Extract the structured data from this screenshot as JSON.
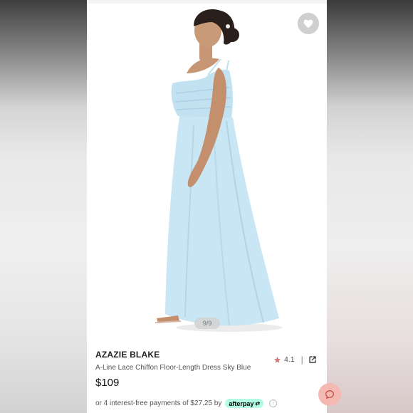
{
  "image": {
    "counter": "9/9"
  },
  "product": {
    "brand": "AZAZIE BLAKE",
    "title": "A-Line Lace Chiffon Floor-Length Dress Sky Blue",
    "price": "$109",
    "rating": "4.1"
  },
  "payment": {
    "text": "or 4 interest-free payments of $27.25 by",
    "provider": "afterpay",
    "info": "i"
  },
  "icons": {
    "favorite": "heart-icon",
    "rating": "star-icon",
    "share": "external-link-icon",
    "chat": "chat-icon"
  },
  "colors": {
    "dress": "#c9e6f5",
    "afterpay": "#b2fce4",
    "star": "#d27a7a",
    "chat": "#f3b9b2"
  }
}
